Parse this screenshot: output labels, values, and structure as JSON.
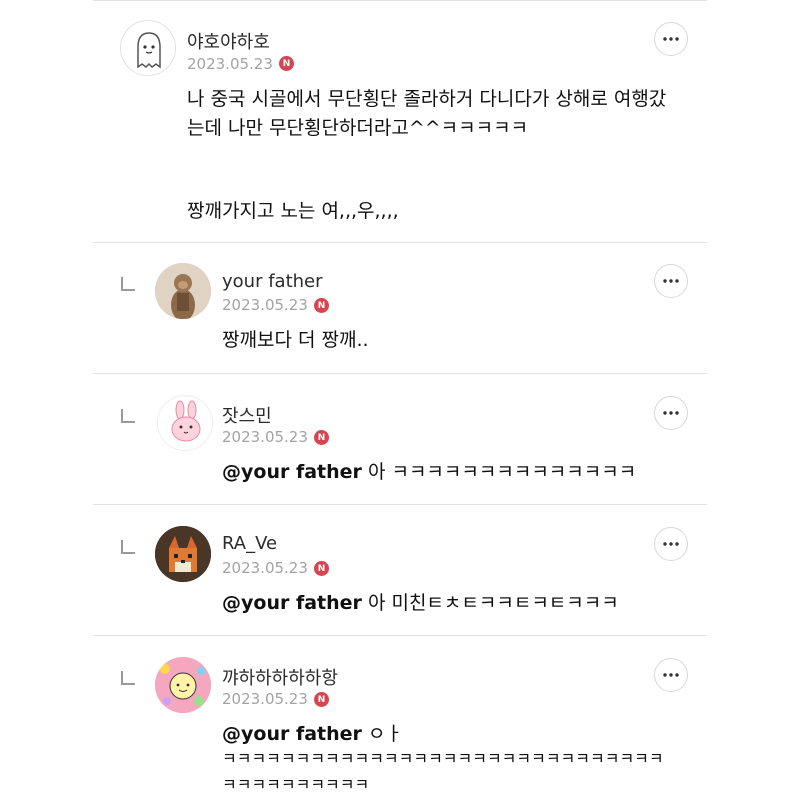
{
  "more_icon": "more-horizontal-icon",
  "badge_label": "N",
  "badge_color": "#d64550",
  "comments": [
    {
      "name": "야호야하호",
      "date": "2023.05.23",
      "lines": [
        "나 중국 시골에서 무단횡단 졸라하거 다니다가 상해로 여행갔",
        "는데 나만 무단횡단하더라고^^ㅋㅋㅋㅋㅋ",
        "",
        "짱깨가지고 노는 여,,,우,,,,"
      ]
    },
    {
      "name": "your father",
      "date": "2023.05.23",
      "text": "짱깨보다 더 짱깨.."
    },
    {
      "name": "잣스민",
      "date": "2023.05.23",
      "mention": "@your father",
      "text": "아 ㅋㅋㅋㅋㅋㅋㅋㅋㅋㅋㅋㅋㅋㅋ"
    },
    {
      "name": "RA_Ve",
      "date": "2023.05.23",
      "mention": "@your father",
      "text": "아 미친ㅌㅊㅌㅋㅋㅌㅋㅌㅋㅋㅋ"
    },
    {
      "name": "꺄하하하하하항",
      "date": "2023.05.23",
      "mention": "@your father",
      "text": "ㅇㅏ",
      "lines": [
        "ㅋㅋㅋㅋㅋㅋㅋㅋㅋㅋㅋㅋㅋㅋㅋㅋㅋㅋㅋㅋㅋㅋㅋㅋㅋㅋㅋㅋㅋㅋ",
        "ㅋㅋㅋㅋㅋㅋㅋㅋㅋㅋ"
      ]
    }
  ]
}
